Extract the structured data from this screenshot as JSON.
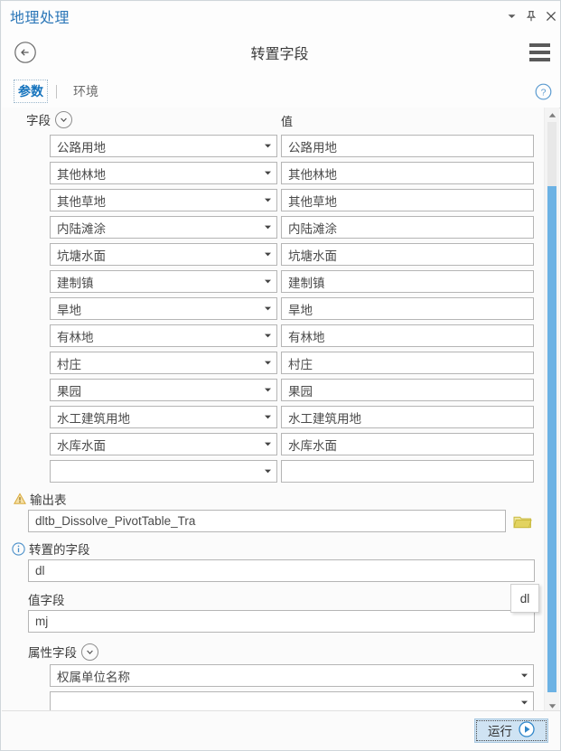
{
  "window": {
    "dock_title": "地理处理",
    "controls": [
      {
        "name": "dropdown-caret",
        "label": "▾"
      },
      {
        "name": "pin",
        "label": "pin"
      },
      {
        "name": "close",
        "label": "✕"
      }
    ]
  },
  "header": {
    "back_label": "back",
    "tool_title": "转置字段",
    "menu_label": "menu"
  },
  "tabs": {
    "items": [
      {
        "label": "参数",
        "active": true
      },
      {
        "label": "环境",
        "active": false
      }
    ],
    "help_label": "?"
  },
  "table": {
    "field_header": "字段",
    "value_header": "值",
    "rows": [
      {
        "field": "公路用地",
        "value": "公路用地"
      },
      {
        "field": "其他林地",
        "value": "其他林地"
      },
      {
        "field": "其他草地",
        "value": "其他草地"
      },
      {
        "field": "内陆滩涂",
        "value": "内陆滩涂"
      },
      {
        "field": "坑塘水面",
        "value": "坑塘水面"
      },
      {
        "field": "建制镇",
        "value": "建制镇"
      },
      {
        "field": "旱地",
        "value": "旱地"
      },
      {
        "field": "有林地",
        "value": "有林地"
      },
      {
        "field": "村庄",
        "value": "村庄"
      },
      {
        "field": "果园",
        "value": "果园"
      },
      {
        "field": "水工建筑用地",
        "value": "水工建筑用地"
      },
      {
        "field": "水库水面",
        "value": "水库水面"
      },
      {
        "field": "",
        "value": ""
      }
    ]
  },
  "form": {
    "output_table": {
      "label": "输出表",
      "status": "warning",
      "value": "dltb_Dissolve_PivotTable_Tra",
      "browse_label": "browse"
    },
    "transposed_field": {
      "label": "转置的字段",
      "status": "info",
      "value": "dl"
    },
    "value_field": {
      "label": "值字段",
      "value": "mj"
    },
    "attribute_fields": {
      "label": "属性字段",
      "rows": [
        "权属单位名称",
        ""
      ]
    }
  },
  "tooltip": {
    "text": "dl"
  },
  "footer": {
    "run_label": "运行"
  },
  "colors": {
    "accent": "#1573bd",
    "dock_title": "#2c77b8",
    "scrollbar_thumb": "#6cb2e4",
    "run_button_bg": "#cfe3f3",
    "warning": "#e8b13a",
    "folder": "#d9c84e"
  }
}
